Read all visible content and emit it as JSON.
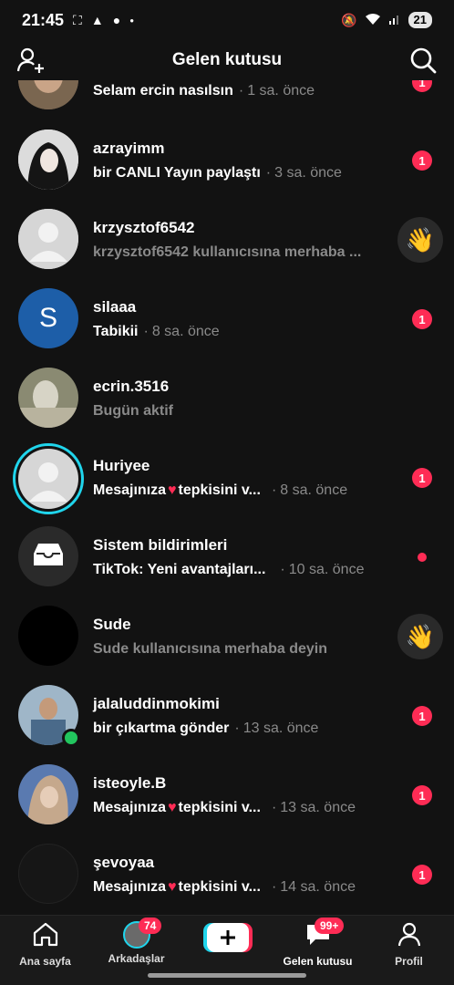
{
  "status": {
    "time": "21:45",
    "battery": "21"
  },
  "header": {
    "title": "Gelen kutusu"
  },
  "rows": [
    {
      "name": "",
      "sub": "Selam ercin nasılsın",
      "time": "1 sa. önce",
      "badge": "1"
    },
    {
      "name": "azrayimm",
      "sub": "bir CANLI Yayın paylaştı",
      "time": "3 sa. önce",
      "badge": "1"
    },
    {
      "name": "krzysztof6542",
      "sub": "krzysztof6542 kullanıcısına merhaba ...",
      "time": "",
      "badge": ""
    },
    {
      "name": "silaaa",
      "sub": "Tabikii",
      "time": "8 sa. önce",
      "badge": "1",
      "avatar_letter": "S"
    },
    {
      "name": "ecrin.3516",
      "sub": "Bugün aktif",
      "time": "",
      "badge": ""
    },
    {
      "name": "Huriyee",
      "sub_pre": "Mesajınıza",
      "sub_post": "tepkisini v...",
      "time": "8 sa. önce",
      "badge": "1"
    },
    {
      "name": "Sistem bildirimleri",
      "sub": "TikTok: Yeni avantajları...",
      "time": "10 sa. önce",
      "badge": ""
    },
    {
      "name": "Sude",
      "sub": "Sude kullanıcısına merhaba deyin",
      "time": "",
      "badge": ""
    },
    {
      "name": "jalaluddinmokimi",
      "sub": "bir çıkartma gönder",
      "time": "13 sa. önce",
      "badge": "1"
    },
    {
      "name": "isteoyle.B",
      "sub_pre": "Mesajınıza",
      "sub_post": "tepkisini v...",
      "time": "13 sa. önce",
      "badge": "1"
    },
    {
      "name": "şevoyaa",
      "sub_pre": "Mesajınıza",
      "sub_post": "tepkisini v...",
      "time": "14 sa. önce",
      "badge": "1"
    }
  ],
  "nav": {
    "home": "Ana sayfa",
    "friends": "Arkadaşlar",
    "friends_badge": "74",
    "inbox": "Gelen kutusu",
    "inbox_badge": "99+",
    "profile": "Profil"
  },
  "colors": {
    "accent": "#fe2c55",
    "background": "#121212",
    "online": "#22c55e",
    "ring": "#20d5ec"
  }
}
